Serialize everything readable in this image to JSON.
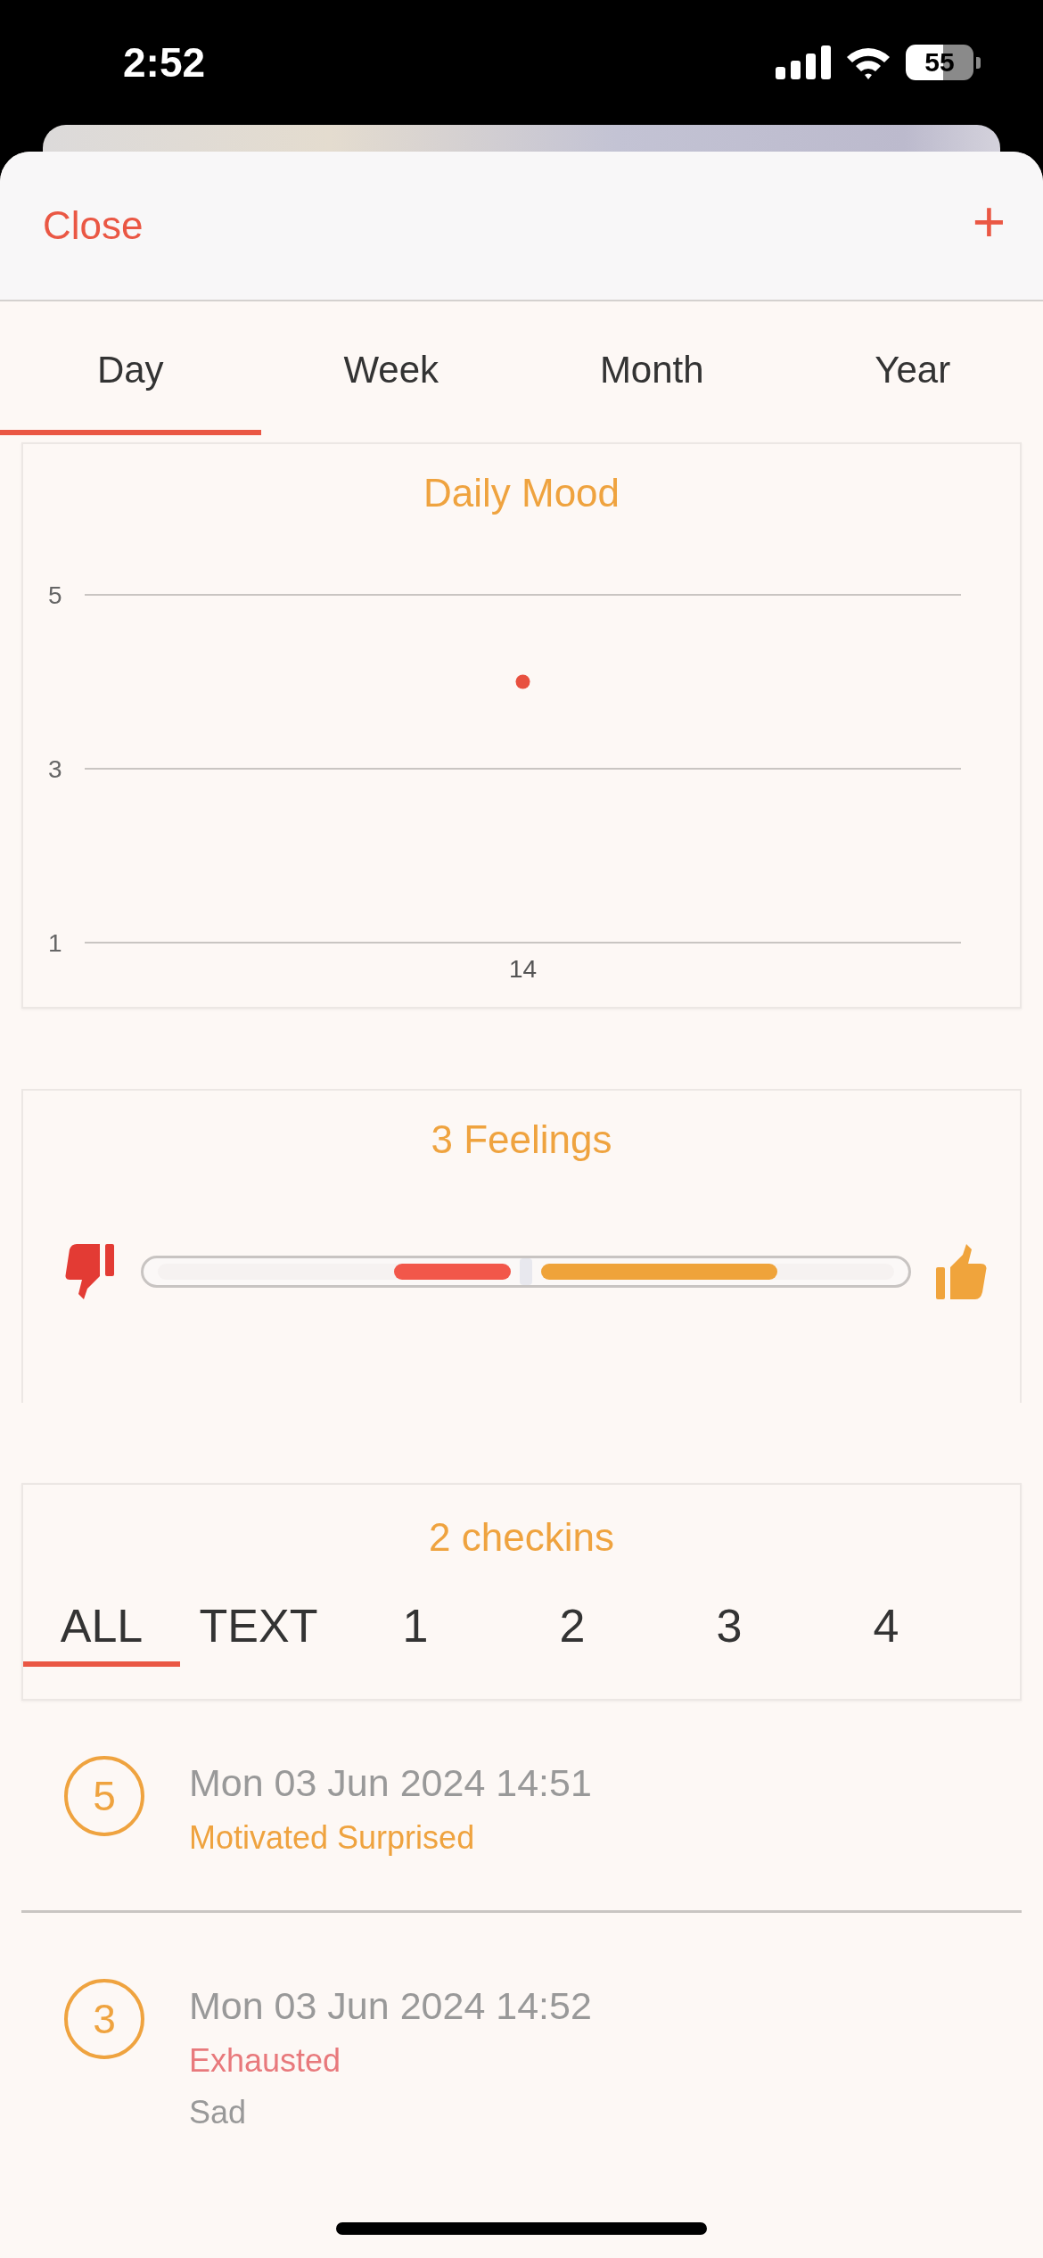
{
  "status_bar": {
    "time": "2:52",
    "battery": "55"
  },
  "header": {
    "close": "Close",
    "add": "+"
  },
  "tabs": [
    {
      "label": "Day",
      "selected": true
    },
    {
      "label": "Week",
      "selected": false
    },
    {
      "label": "Month",
      "selected": false
    },
    {
      "label": "Year",
      "selected": false
    }
  ],
  "mood_card": {
    "title": "Daily Mood",
    "chart_data": {
      "type": "scatter",
      "categories": [
        "14"
      ],
      "values": [
        4
      ],
      "ylim": [
        1,
        5
      ],
      "yticks": [
        1,
        3,
        5
      ]
    }
  },
  "feelings_card": {
    "title": "3 Feelings",
    "negative": {
      "level": 0.33
    },
    "positive": {
      "level": 0.67
    }
  },
  "checkins_card": {
    "title": "2 checkins",
    "filters": [
      {
        "label": "ALL",
        "selected": true
      },
      {
        "label": "TEXT",
        "selected": false
      },
      {
        "label": "1",
        "selected": false
      },
      {
        "label": "2",
        "selected": false
      },
      {
        "label": "3",
        "selected": false
      },
      {
        "label": "4",
        "selected": false
      }
    ]
  },
  "checkins": [
    {
      "mood": "5",
      "date": "Mon 03 Jun 2024 14:51",
      "feelings": [
        {
          "text": "Motivated Surprised",
          "kind": "positive"
        }
      ]
    },
    {
      "mood": "3",
      "date": "Mon 03 Jun 2024 14:52",
      "feelings": [
        {
          "text": "Exhausted",
          "kind": "negative"
        },
        {
          "text": "Sad",
          "kind": "neutral"
        }
      ]
    }
  ]
}
